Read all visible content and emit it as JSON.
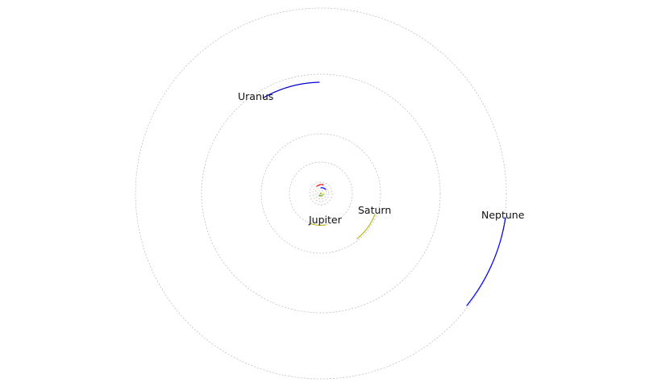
{
  "diagram": {
    "type": "orbital-plot",
    "center_dot_color": "#bcbd22",
    "planets": [
      {
        "id": "mercury",
        "label": "",
        "color": "#00bcbc"
      },
      {
        "id": "venus",
        "label": "",
        "color": "#bcbd22"
      },
      {
        "id": "earth",
        "label": "",
        "color": "#0000ff"
      },
      {
        "id": "mars",
        "label": "",
        "color": "#ff0000"
      },
      {
        "id": "jupiter",
        "label": "Jupiter",
        "color": "#bcbd22"
      },
      {
        "id": "saturn",
        "label": "Saturn",
        "color": "#bcbd22"
      },
      {
        "id": "uranus",
        "label": "Uranus",
        "color": "#0000cc"
      },
      {
        "id": "neptune",
        "label": "Neptune",
        "color": "#0000ff"
      }
    ]
  }
}
